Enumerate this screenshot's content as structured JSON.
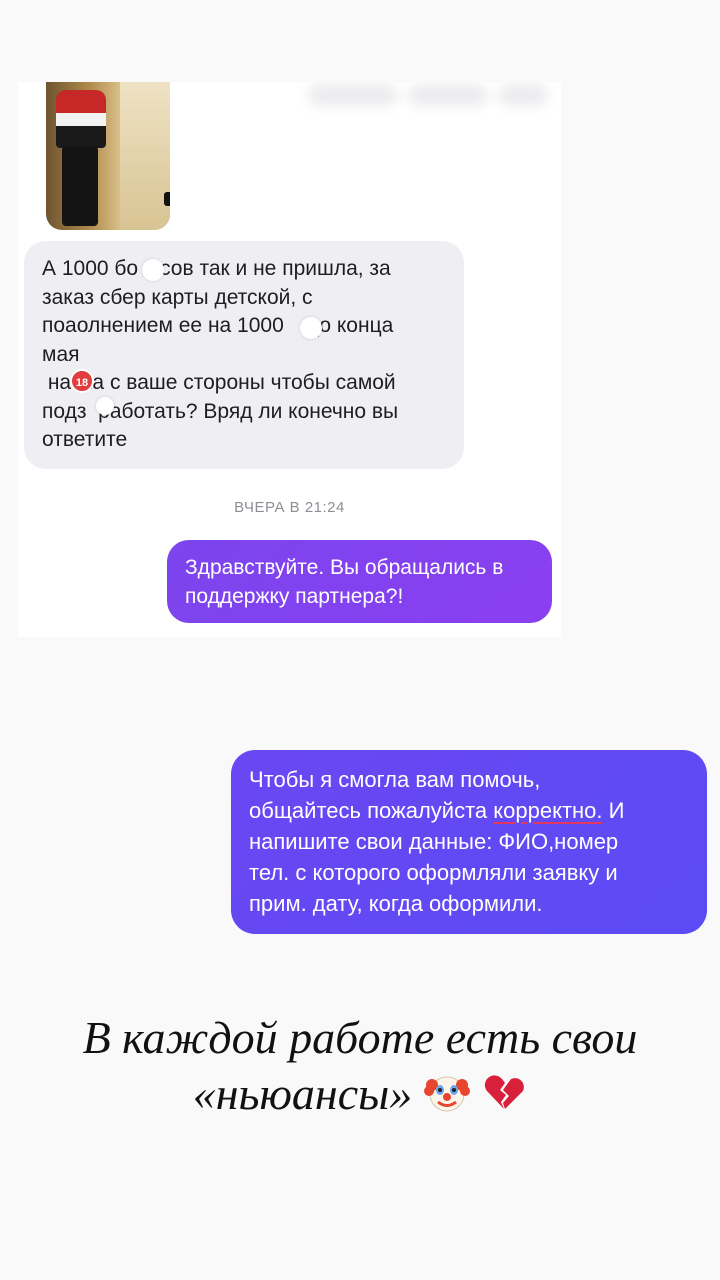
{
  "incoming_message": {
    "lines": [
      "А 1000 бо  усов так и не пришла, за",
      "заказ сбер карты детской, с",
      "поаолнением ее на 1000    до конца",
      "мая",
      " на  ка с ваше стороны чтобы самой",
      "подз  работать? Вряд ли конечно вы",
      "ответите"
    ]
  },
  "timestamp": "ВЧЕРА В 21:24",
  "outgoing_message_1": {
    "lines": [
      "Здравствуйте. Вы обращались в",
      "поддержку партнера?!"
    ]
  },
  "outgoing_message_2": {
    "line1": "Чтобы я смогла вам помочь,",
    "line2_prefix": "общайтесь пожалуйста ",
    "line2_underlined": "корректно.",
    "line2_suffix": " И",
    "line3": "напишите свои данные: ФИО,номер",
    "line4": "тел. с которого оформляли заявку и",
    "line5": "прим. дату, когда оформили."
  },
  "caption": {
    "line1": "В каждой работе есть свои",
    "line2": "«ньюансы»"
  },
  "sticker_badge": "18",
  "icons": [
    "clown-face-icon",
    "broken-heart-icon"
  ],
  "colors": {
    "outgoing_bubble": "#7b45ee",
    "outgoing_bubble_2": "#5b4bf5",
    "incoming_bubble": "#efeff3",
    "underline": "#e2375f"
  }
}
